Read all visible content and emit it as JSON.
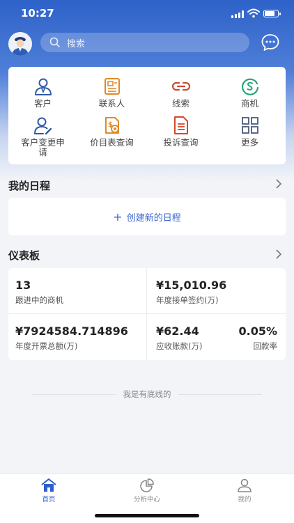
{
  "status_bar": {
    "time": "10:27"
  },
  "header": {
    "search_placeholder": "搜索"
  },
  "menu": [
    {
      "label": "客户",
      "icon": "customer-icon"
    },
    {
      "label": "联系人",
      "icon": "contact-card-icon"
    },
    {
      "label": "线索",
      "icon": "link-icon"
    },
    {
      "label": "商机",
      "icon": "opportunity-icon"
    },
    {
      "label": "客户变更申请",
      "icon": "customer-edit-icon"
    },
    {
      "label": "价目表查询",
      "icon": "price-list-icon"
    },
    {
      "label": "投诉查询",
      "icon": "document-icon"
    },
    {
      "label": "更多",
      "icon": "grid-icon"
    }
  ],
  "schedule": {
    "title": "我的日程",
    "create_label": "创建新的日程"
  },
  "dashboard": {
    "title": "仪表板",
    "opportunities_value": "13",
    "opportunities_label": "跟进中的商机",
    "contract_value": "¥15,010.96",
    "contract_label": "年度接单签约(万)",
    "invoice_value": "¥7924584.714896",
    "invoice_label": "年度开票总额(万)",
    "receivable_value": "¥62.44",
    "receivable_label": "应收账款(万)",
    "collection_rate_value": "0.05%",
    "collection_rate_label": "回款率"
  },
  "footer": {
    "text": "我是有底线的"
  },
  "tabbar": [
    {
      "label": "首页",
      "icon": "home-icon",
      "active": true
    },
    {
      "label": "分析中心",
      "icon": "pie-chart-icon",
      "active": false
    },
    {
      "label": "我的",
      "icon": "user-icon",
      "active": false
    }
  ],
  "colors": {
    "accent": "#2f5fc9",
    "icon_blue": "#2f5aa8",
    "icon_orange": "#e08a2a",
    "icon_red": "#d14a2c",
    "icon_green": "#2aa47a",
    "icon_gray": "#4a5a78"
  }
}
